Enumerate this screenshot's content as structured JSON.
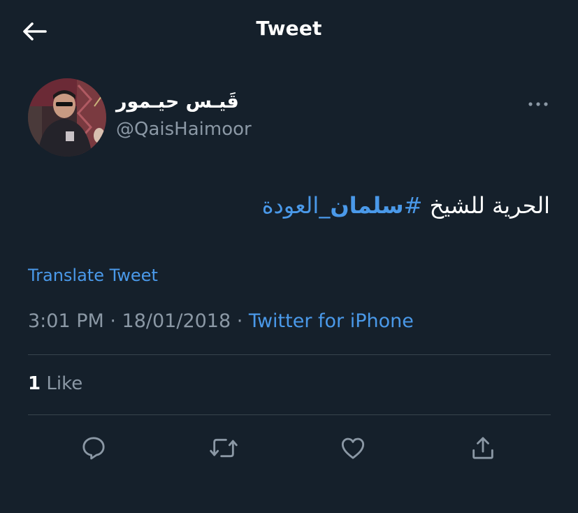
{
  "header": {
    "title": "Tweet",
    "back_icon": "arrow-left-icon"
  },
  "author": {
    "display_name": "قَيـس حيـمور",
    "handle": "@QaisHaimoor",
    "avatar_icon": "user-avatar"
  },
  "tweet": {
    "text_prefix": "الحرية للشيخ",
    "hashtag_mark": "#",
    "hashtag_bold": "سلمان",
    "hashtag_rest": "_العودة",
    "translate_label": "Translate Tweet",
    "time": "3:01 PM",
    "separator": " · ",
    "date": "18/01/2018",
    "source": "Twitter for iPhone"
  },
  "stats": {
    "like_count": "1",
    "like_label": " Like"
  },
  "actions": {
    "reply_icon": "reply-icon",
    "retweet_icon": "retweet-icon",
    "like_icon": "heart-icon",
    "share_icon": "share-icon"
  },
  "colors": {
    "background": "#15202b",
    "accent": "#4a99e9",
    "secondary_text": "#8b98a5",
    "divider": "#38444d"
  }
}
